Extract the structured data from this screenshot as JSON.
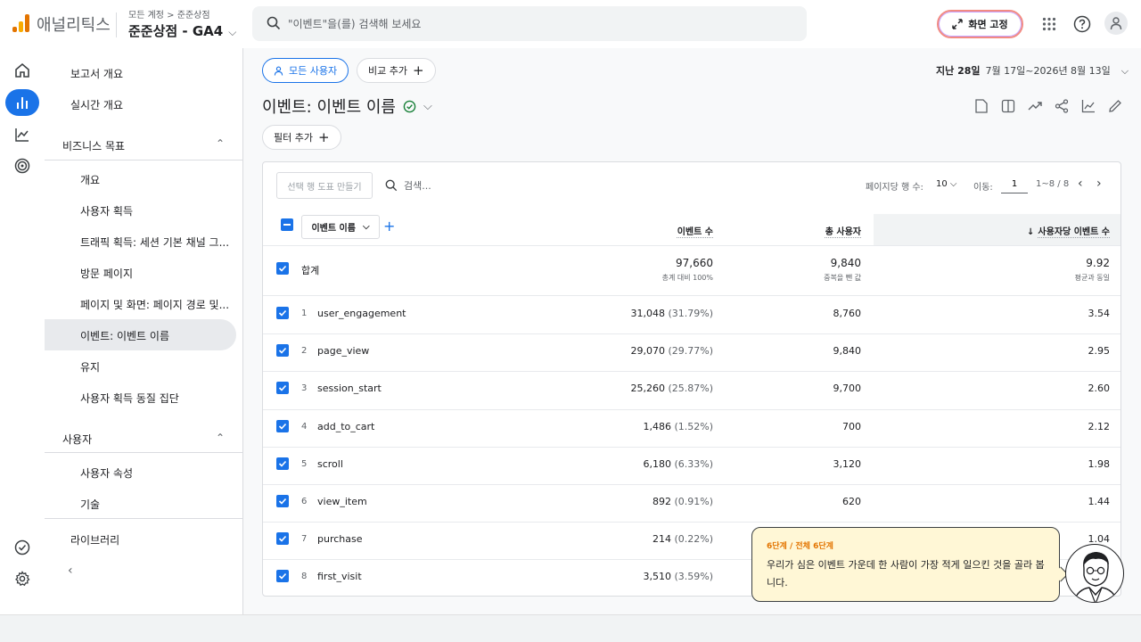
{
  "header": {
    "brand": "애널리틱스",
    "breadcrumb_account": "모든 계정",
    "breadcrumb_sep": ">",
    "breadcrumb_property": "준준상점",
    "property_name": "준준상점 - GA4",
    "search_placeholder": "\"이벤트\"을(를) 검색해 보세요",
    "fix_button": "화면 고정"
  },
  "nav": {
    "report_overview": "보고서 개요",
    "realtime_overview": "실시간 개요",
    "business_goals": "비즈니스 목표",
    "goal_items": [
      "개요",
      "사용자 획득",
      "트래픽 획득: 세션 기본 채널 그...",
      "방문 페이지",
      "페이지 및 화면: 페이지 경로 및...",
      "이벤트: 이벤트 이름",
      "유지",
      "사용자 획득 동질 집단"
    ],
    "users": "사용자",
    "user_items": [
      "사용자 속성",
      "기술"
    ],
    "library": "라이브러리"
  },
  "main": {
    "all_users_chip": "모든 사용자",
    "compare_chip": "비교 추가",
    "date_label": "지난 28일",
    "date_range": "7월 17일~2026년 8월 13일",
    "page_title": "이벤트: 이벤트 이름",
    "filter_chip": "필터 추가"
  },
  "table": {
    "make_chart": "선택 행 도표 만들기",
    "search_placeholder": "검색...",
    "rows_per_page_label": "페이지당 행 수:",
    "rows_per_page": "10",
    "goto_label": "이동:",
    "goto_value": "1",
    "range": "1~8 / 8",
    "dimension": "이벤트 이름",
    "col_events": "이벤트 수",
    "col_users": "총 사용자",
    "col_per_user": "사용자당 이벤트 수",
    "total": {
      "label": "합계",
      "events": "97,660",
      "events_sub": "총계 대비 100%",
      "users": "9,840",
      "users_sub": "중복을 뺀 값",
      "per_user": "9.92",
      "per_user_sub": "평균과 동일"
    },
    "rows": [
      {
        "idx": "1",
        "name": "user_engagement",
        "events": "31,048",
        "pct": "(31.79%)",
        "users": "8,760",
        "per_user": "3.54"
      },
      {
        "idx": "2",
        "name": "page_view",
        "events": "29,070",
        "pct": "(29.77%)",
        "users": "9,840",
        "per_user": "2.95"
      },
      {
        "idx": "3",
        "name": "session_start",
        "events": "25,260",
        "pct": "(25.87%)",
        "users": "9,700",
        "per_user": "2.60"
      },
      {
        "idx": "4",
        "name": "add_to_cart",
        "events": "1,486",
        "pct": "(1.52%)",
        "users": "700",
        "per_user": "2.12"
      },
      {
        "idx": "5",
        "name": "scroll",
        "events": "6,180",
        "pct": "(6.33%)",
        "users": "3,120",
        "per_user": "1.98"
      },
      {
        "idx": "6",
        "name": "view_item",
        "events": "892",
        "pct": "(0.91%)",
        "users": "620",
        "per_user": "1.44"
      },
      {
        "idx": "7",
        "name": "purchase",
        "events": "214",
        "pct": "(0.22%)",
        "users": "",
        "per_user": "1.04"
      },
      {
        "idx": "8",
        "name": "first_visit",
        "events": "3,510",
        "pct": "(3.59%)",
        "users": "",
        "per_user": ""
      }
    ]
  },
  "tooltip": {
    "step": "6단계 / 전체 6단계",
    "text": "우리가 심은 이벤트 가운데 한 사람이 가장 적게 일으킨 것을 골라 봅니다."
  },
  "colors": {
    "accent": "#1a73e8",
    "tooltip_bg": "#fff7d6",
    "step_orange": "#e37400"
  }
}
